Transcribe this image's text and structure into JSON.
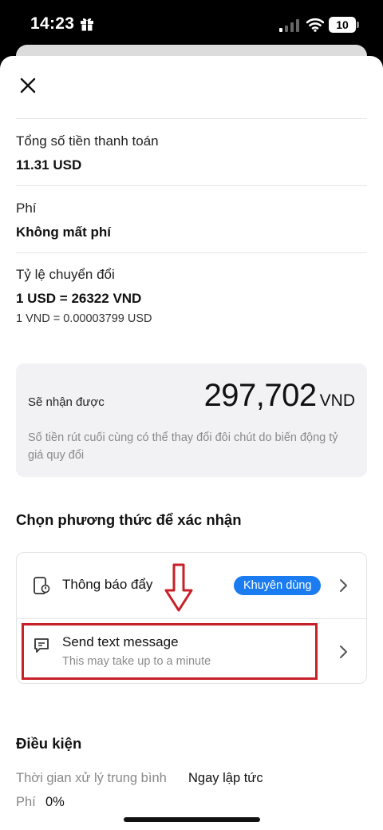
{
  "status_bar": {
    "time": "14:23",
    "battery": "10"
  },
  "summary": {
    "total_label": "Tổng số tiền thanh toán",
    "total_value": "11.31 USD",
    "fee_label": "Phí",
    "fee_value": "Không mất phí",
    "rate_label": "Tỷ lệ chuyển đổi",
    "rate_value": "1 USD = 26322 VND",
    "rate_inverse": "1 VND = 0.00003799 USD"
  },
  "receive": {
    "label": "Sẽ nhận được",
    "amount": "297,702",
    "currency": "VND",
    "note": "Số tiền rút cuối cùng có thể thay đổi đôi chút do biến động tỷ giá quy đổi"
  },
  "verify": {
    "title": "Chọn phương thức để xác nhận",
    "options": [
      {
        "title": "Thông báo đẩy",
        "badge": "Khuyên dùng",
        "icon": "phone-notification-icon"
      },
      {
        "title": "Send text message",
        "subtitle": "This may take up to a minute",
        "icon": "chat-bubble-icon"
      }
    ]
  },
  "conditions": {
    "title": "Điều kiện",
    "rows": [
      {
        "label": "Thời gian xử lý trung bình",
        "value": "Ngay lập tức"
      },
      {
        "label": "Phí",
        "value": "0%"
      }
    ]
  },
  "colors": {
    "accent": "#1a7cf0",
    "highlight": "#c8202a",
    "card_bg": "#f2f2f4"
  },
  "icons": [
    "gift-icon",
    "signal-icon",
    "wifi-icon",
    "close-icon",
    "phone-notification-icon",
    "chat-bubble-icon",
    "chevron-right-icon",
    "down-arrow-annotation"
  ]
}
